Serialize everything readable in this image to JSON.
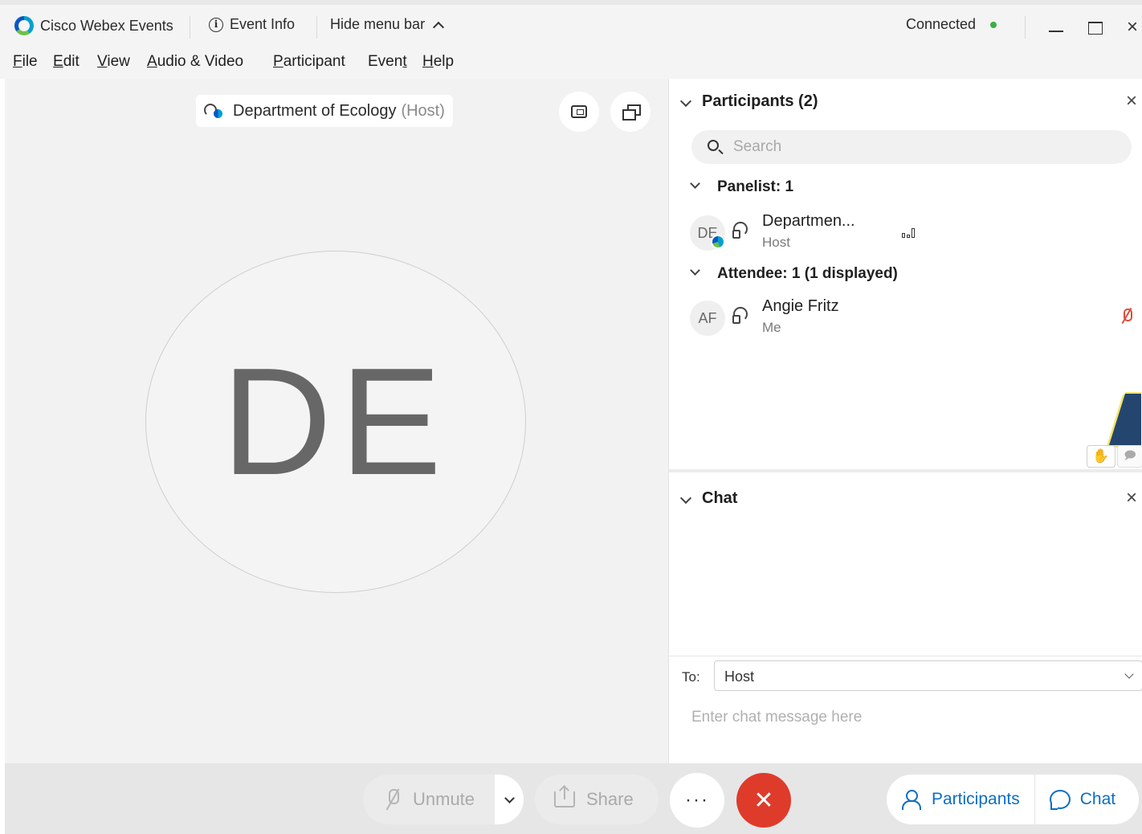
{
  "titlebar": {
    "app_name": "Cisco Webex Events",
    "event_info": "Event Info",
    "hide_menu": "Hide menu bar",
    "status": "Connected",
    "status_color": "#3cb043"
  },
  "menu": [
    {
      "mnemonic": "F",
      "rest": "ile"
    },
    {
      "mnemonic": "E",
      "rest": "dit"
    },
    {
      "mnemonic": "V",
      "rest": "iew"
    },
    {
      "mnemonic": "A",
      "rest": "udio & Video"
    },
    {
      "mnemonic": "P",
      "rest": "articipant"
    },
    {
      "pre": "Even",
      "mnemonic": "t",
      "rest": ""
    },
    {
      "mnemonic": "H",
      "rest": "elp"
    }
  ],
  "stage": {
    "speaker_name": "Department of Ecology",
    "speaker_role": "(Host)",
    "avatar_initials": "DE"
  },
  "participants_panel": {
    "title": "Participants (2)",
    "search_placeholder": "Search",
    "panelist_group": "Panelist: 1",
    "attendee_group": "Attendee: 1 (1 displayed)",
    "panelists": [
      {
        "initials": "DE",
        "name": "Departmen...",
        "role": "Host"
      }
    ],
    "attendees": [
      {
        "initials": "AF",
        "name": "Angie Fritz",
        "role": "Me"
      }
    ]
  },
  "chat_panel": {
    "title": "Chat",
    "to_label": "To:",
    "to_value": "Host",
    "input_placeholder": "Enter chat message here"
  },
  "controls": {
    "unmute": "Unmute",
    "share": "Share",
    "more": "···",
    "leave_symbol": "✕",
    "participants": "Participants",
    "chat": "Chat",
    "leave_color": "#df3b2b",
    "accent_color": "#0b6ec4"
  },
  "icons": {
    "close": "×",
    "hand": "✋",
    "speak": "🗩"
  }
}
